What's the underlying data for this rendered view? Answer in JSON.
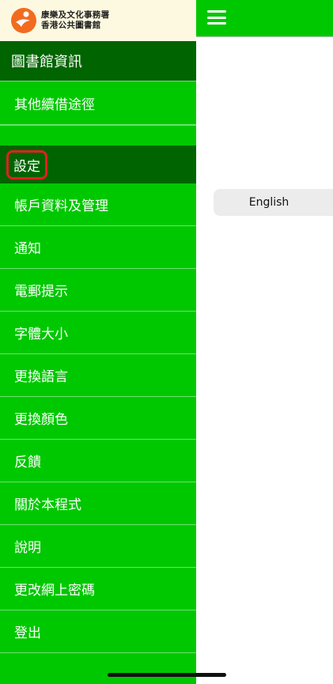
{
  "brand": {
    "line1": "康樂及文化事務署",
    "line2": "香港公共圖書館"
  },
  "menu": {
    "library_info_header": "圖書館資訊",
    "other_renewal": "其他續借途徑",
    "settings_header": "設定",
    "items": [
      "帳戶資料及管理",
      "通知",
      "電郵提示",
      "字體大小",
      "更換語言",
      "更換顏色",
      "反饋",
      "關於本程式",
      "說明",
      "更改網上密碼",
      "登出"
    ]
  },
  "content": {
    "language_button": "English"
  },
  "colors": {
    "menu_green": "#00c800",
    "header_dark_green": "#006400",
    "highlight_red": "#e02020"
  }
}
